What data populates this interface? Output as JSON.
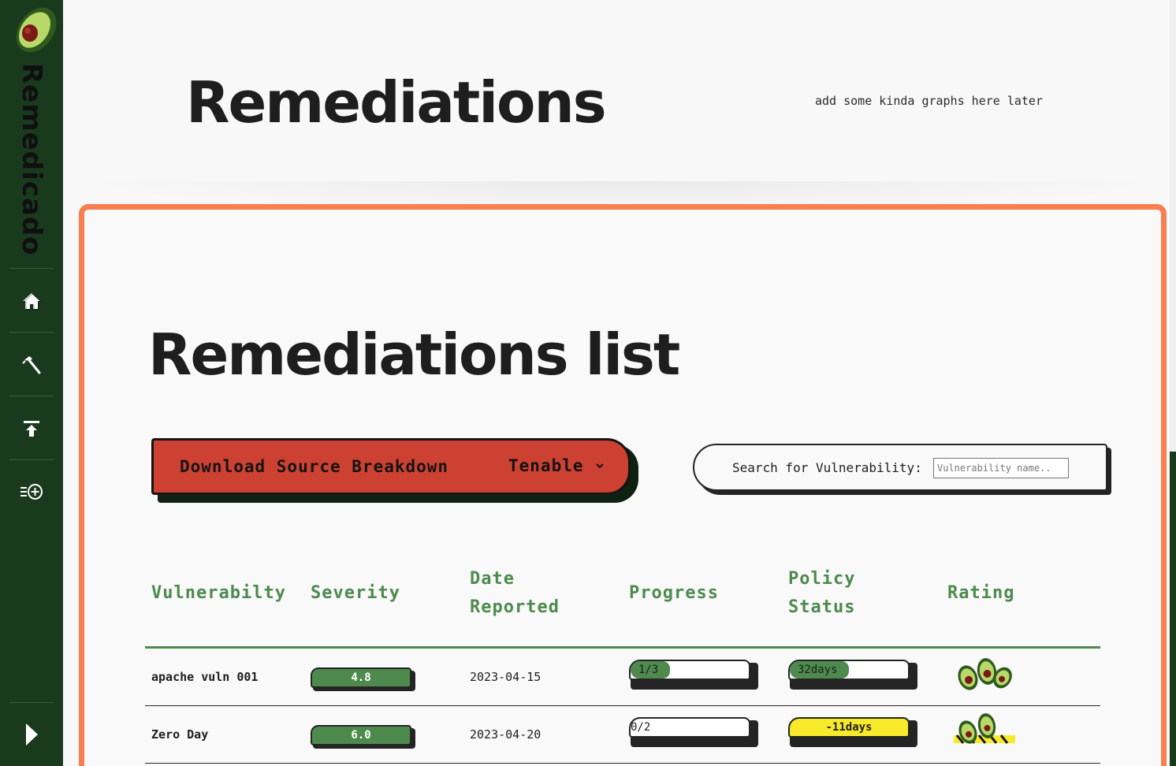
{
  "app": {
    "brand": "Remedicado"
  },
  "sidebar": {
    "items": [
      {
        "name": "home",
        "icon": "home-icon"
      },
      {
        "name": "tools",
        "icon": "hammer-icon"
      },
      {
        "name": "upload",
        "icon": "upload-icon"
      },
      {
        "name": "add",
        "icon": "add-entry-icon"
      }
    ],
    "expand_icon": "chevron-right-icon"
  },
  "header": {
    "title": "Remediations",
    "note": "add some kinda graphs here later"
  },
  "main": {
    "title": "Remediations list",
    "download": {
      "label": "Download Source Breakdown",
      "selected_source": "Tenable"
    },
    "search": {
      "label": "Search for Vulnerability:",
      "placeholder": "Vulnerability name..",
      "value": ""
    },
    "table": {
      "headers": {
        "vulnerability": "Vulnerabilty",
        "severity": "Severity",
        "date_line1": "Date",
        "date_line2": "Reported",
        "progress": "Progress",
        "policy_line1": "Policy",
        "policy_line2": "Status",
        "rating": "Rating"
      },
      "rows": [
        {
          "name": "apache vuln 001",
          "severity": "4.8",
          "date": "2023-04-15",
          "progress": "1/3",
          "progress_fraction": 0.33,
          "policy": "32days",
          "policy_fraction": 0.5,
          "policy_state": "ok"
        },
        {
          "name": "Zero Day",
          "severity": "6.0",
          "date": "2023-04-20",
          "progress": "0/2",
          "progress_fraction": 0.0,
          "policy": "-11days",
          "policy_fraction": 1.0,
          "policy_state": "overdue"
        }
      ]
    }
  },
  "colors": {
    "sidebar": "#1a3a1d",
    "accent_green": "#4e8a4e",
    "panel_border": "#f87f4f",
    "button_red": "#cc4131",
    "warning_yellow": "#f8ea2a"
  }
}
